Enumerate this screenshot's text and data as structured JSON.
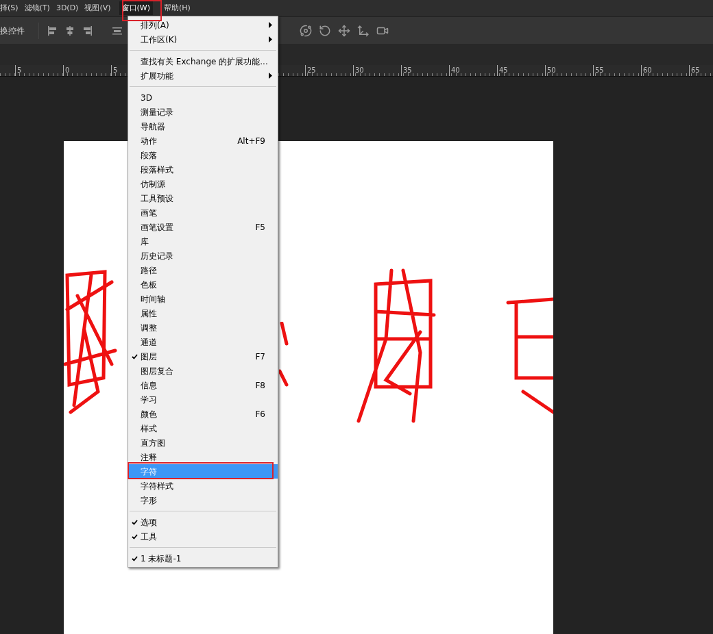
{
  "menu_bar": [
    {
      "label": "择(S)",
      "selected": false
    },
    {
      "label": "滤镜(T)",
      "selected": false
    },
    {
      "label": "3D(D)",
      "selected": false
    },
    {
      "label": "视图(V)",
      "selected": false
    },
    {
      "label": "窗口(W)",
      "selected": true
    },
    {
      "label": "帮助(H)",
      "selected": false
    }
  ],
  "options_bar": {
    "label": "换控件"
  },
  "ruler": {
    "left_labels": [
      "5",
      "0",
      "5"
    ],
    "right_labels": [
      "25",
      "30",
      "35",
      "40",
      "45",
      "50",
      "55",
      "60",
      "65"
    ]
  },
  "window_menu": [
    {
      "kind": "item",
      "label": "排列(A)",
      "submenu": true,
      "checked": false,
      "selected": false
    },
    {
      "kind": "item",
      "label": "工作区(K)",
      "submenu": true,
      "checked": false,
      "selected": false
    },
    {
      "kind": "separator"
    },
    {
      "kind": "item",
      "label": "查找有关 Exchange 的扩展功能...",
      "submenu": false,
      "checked": false,
      "selected": false
    },
    {
      "kind": "item",
      "label": "扩展功能",
      "submenu": true,
      "checked": false,
      "selected": false
    },
    {
      "kind": "separator"
    },
    {
      "kind": "item",
      "label": "3D",
      "submenu": false,
      "checked": false,
      "selected": false
    },
    {
      "kind": "item",
      "label": "测量记录",
      "submenu": false,
      "checked": false,
      "selected": false
    },
    {
      "kind": "item",
      "label": "导航器",
      "submenu": false,
      "checked": false,
      "selected": false
    },
    {
      "kind": "item",
      "label": "动作",
      "shortcut": "Alt+F9",
      "submenu": false,
      "checked": false,
      "selected": false
    },
    {
      "kind": "item",
      "label": "段落",
      "submenu": false,
      "checked": false,
      "selected": false
    },
    {
      "kind": "item",
      "label": "段落样式",
      "submenu": false,
      "checked": false,
      "selected": false
    },
    {
      "kind": "item",
      "label": "仿制源",
      "submenu": false,
      "checked": false,
      "selected": false
    },
    {
      "kind": "item",
      "label": "工具预设",
      "submenu": false,
      "checked": false,
      "selected": false
    },
    {
      "kind": "item",
      "label": "画笔",
      "submenu": false,
      "checked": false,
      "selected": false
    },
    {
      "kind": "item",
      "label": "画笔设置",
      "shortcut": "F5",
      "submenu": false,
      "checked": false,
      "selected": false
    },
    {
      "kind": "item",
      "label": "库",
      "submenu": false,
      "checked": false,
      "selected": false
    },
    {
      "kind": "item",
      "label": "历史记录",
      "submenu": false,
      "checked": false,
      "selected": false
    },
    {
      "kind": "item",
      "label": "路径",
      "submenu": false,
      "checked": false,
      "selected": false
    },
    {
      "kind": "item",
      "label": "色板",
      "submenu": false,
      "checked": false,
      "selected": false
    },
    {
      "kind": "item",
      "label": "时间轴",
      "submenu": false,
      "checked": false,
      "selected": false
    },
    {
      "kind": "item",
      "label": "属性",
      "submenu": false,
      "checked": false,
      "selected": false
    },
    {
      "kind": "item",
      "label": "调整",
      "submenu": false,
      "checked": false,
      "selected": false
    },
    {
      "kind": "item",
      "label": "通道",
      "submenu": false,
      "checked": false,
      "selected": false
    },
    {
      "kind": "item",
      "label": "图层",
      "shortcut": "F7",
      "submenu": false,
      "checked": true,
      "selected": false
    },
    {
      "kind": "item",
      "label": "图层复合",
      "submenu": false,
      "checked": false,
      "selected": false
    },
    {
      "kind": "item",
      "label": "信息",
      "shortcut": "F8",
      "submenu": false,
      "checked": false,
      "selected": false
    },
    {
      "kind": "item",
      "label": "学习",
      "submenu": false,
      "checked": false,
      "selected": false
    },
    {
      "kind": "item",
      "label": "颜色",
      "shortcut": "F6",
      "submenu": false,
      "checked": false,
      "selected": false
    },
    {
      "kind": "item",
      "label": "样式",
      "submenu": false,
      "checked": false,
      "selected": false
    },
    {
      "kind": "item",
      "label": "直方图",
      "submenu": false,
      "checked": false,
      "selected": false
    },
    {
      "kind": "item",
      "label": "注释",
      "submenu": false,
      "checked": false,
      "selected": false
    },
    {
      "kind": "item",
      "label": "字符",
      "submenu": false,
      "checked": false,
      "selected": true
    },
    {
      "kind": "item",
      "label": "字符样式",
      "submenu": false,
      "checked": false,
      "selected": false
    },
    {
      "kind": "item",
      "label": "字形",
      "submenu": false,
      "checked": false,
      "selected": false
    },
    {
      "kind": "separator"
    },
    {
      "kind": "item",
      "label": "选项",
      "submenu": false,
      "checked": true,
      "selected": false
    },
    {
      "kind": "item",
      "label": "工具",
      "submenu": false,
      "checked": true,
      "selected": false
    },
    {
      "kind": "separator"
    },
    {
      "kind": "item",
      "label": "1 未标题-1",
      "submenu": false,
      "checked": true,
      "selected": false
    }
  ]
}
